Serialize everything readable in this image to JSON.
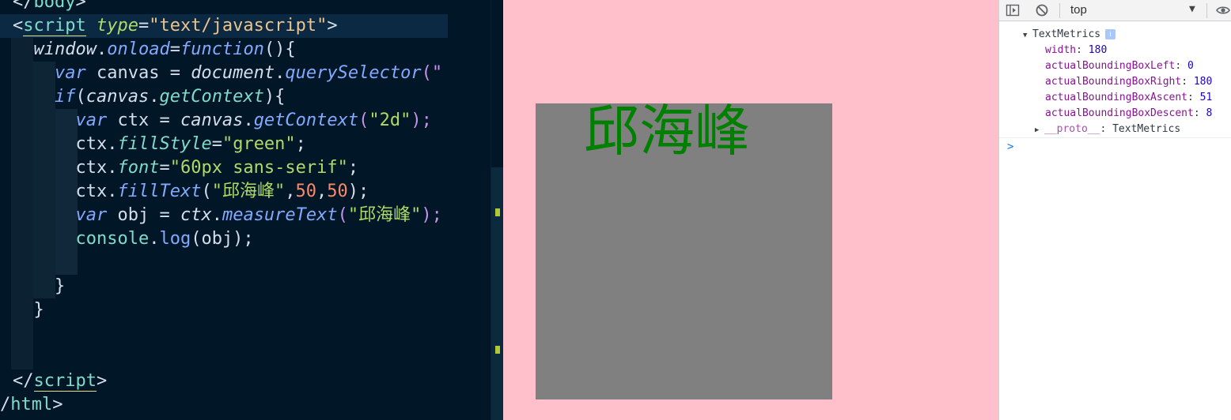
{
  "editor": {
    "lines": [
      [
        {
          "t": "</",
          "c": "punct"
        },
        {
          "t": "body",
          "c": "tag"
        },
        {
          "t": ">",
          "c": "punct"
        }
      ],
      [
        {
          "t": "<",
          "c": "punct"
        },
        {
          "t": "script",
          "c": "tag",
          "u": true
        },
        {
          "t": " ",
          "c": "punct"
        },
        {
          "t": "type",
          "c": "attr"
        },
        {
          "t": "=",
          "c": "punct"
        },
        {
          "t": "\"text/javascript\"",
          "c": "str"
        },
        {
          "t": ">",
          "c": "punct"
        }
      ],
      [
        {
          "t": "  ",
          "c": "punct"
        },
        {
          "t": "window",
          "c": "var"
        },
        {
          "t": ".",
          "c": "punct"
        },
        {
          "t": "onload",
          "c": "fn"
        },
        {
          "t": "=",
          "c": "punct"
        },
        {
          "t": "function",
          "c": "kw"
        },
        {
          "t": "(){",
          "c": "punct"
        }
      ],
      [
        {
          "t": "    ",
          "c": "punct"
        },
        {
          "t": "var",
          "c": "kw"
        },
        {
          "t": " canvas = ",
          "c": "ident"
        },
        {
          "t": "document",
          "c": "var"
        },
        {
          "t": ".",
          "c": "punct"
        },
        {
          "t": "querySelector",
          "c": "fn"
        },
        {
          "t": "(\"",
          "c": "paren"
        }
      ],
      [
        {
          "t": "    ",
          "c": "punct"
        },
        {
          "t": "if",
          "c": "kw"
        },
        {
          "t": "(",
          "c": "punct"
        },
        {
          "t": "canvas",
          "c": "var"
        },
        {
          "t": ".",
          "c": "punct"
        },
        {
          "t": "getContext",
          "c": "prop"
        },
        {
          "t": "){",
          "c": "punct"
        }
      ],
      [
        {
          "t": "      ",
          "c": "punct"
        },
        {
          "t": "var",
          "c": "kw"
        },
        {
          "t": " ctx = ",
          "c": "ident"
        },
        {
          "t": "canvas",
          "c": "var"
        },
        {
          "t": ".",
          "c": "punct"
        },
        {
          "t": "getContext",
          "c": "fn"
        },
        {
          "t": "(",
          "c": "paren"
        },
        {
          "t": "\"2d\"",
          "c": "str2"
        },
        {
          "t": ");",
          "c": "paren"
        }
      ],
      [
        {
          "t": "      ",
          "c": "punct"
        },
        {
          "t": "ctx",
          "c": "ident"
        },
        {
          "t": ".",
          "c": "punct"
        },
        {
          "t": "fillStyle",
          "c": "prop"
        },
        {
          "t": "=",
          "c": "punct"
        },
        {
          "t": "\"green\"",
          "c": "str2"
        },
        {
          "t": ";",
          "c": "punct"
        }
      ],
      [
        {
          "t": "      ",
          "c": "punct"
        },
        {
          "t": "ctx",
          "c": "ident"
        },
        {
          "t": ".",
          "c": "punct"
        },
        {
          "t": "font",
          "c": "prop"
        },
        {
          "t": "=",
          "c": "punct"
        },
        {
          "t": "\"60px sans-serif\"",
          "c": "str2"
        },
        {
          "t": ";",
          "c": "punct"
        }
      ],
      [
        {
          "t": "      ",
          "c": "punct"
        },
        {
          "t": "ctx",
          "c": "ident"
        },
        {
          "t": ".",
          "c": "punct"
        },
        {
          "t": "fillText",
          "c": "fn"
        },
        {
          "t": "(",
          "c": "punct"
        },
        {
          "t": "\"邱海峰\"",
          "c": "str2"
        },
        {
          "t": ",",
          "c": "punct"
        },
        {
          "t": "50",
          "c": "num"
        },
        {
          "t": ",",
          "c": "punct"
        },
        {
          "t": "50",
          "c": "num"
        },
        {
          "t": ");",
          "c": "punct"
        }
      ],
      [
        {
          "t": "      ",
          "c": "punct"
        },
        {
          "t": "var",
          "c": "kw"
        },
        {
          "t": " obj = ",
          "c": "ident"
        },
        {
          "t": "ctx",
          "c": "var"
        },
        {
          "t": ".",
          "c": "punct"
        },
        {
          "t": "measureText",
          "c": "fn"
        },
        {
          "t": "(",
          "c": "paren"
        },
        {
          "t": "\"邱海峰\"",
          "c": "str2"
        },
        {
          "t": ");",
          "c": "paren"
        }
      ],
      [
        {
          "t": "      ",
          "c": "punct"
        },
        {
          "t": "console",
          "c": "prop2"
        },
        {
          "t": ".",
          "c": "punct"
        },
        {
          "t": "log",
          "c": "fn2"
        },
        {
          "t": "(obj);",
          "c": "punct"
        }
      ],
      [
        {
          "t": "",
          "c": "punct"
        }
      ],
      [
        {
          "t": "    }",
          "c": "punct"
        }
      ],
      [
        {
          "t": "  }",
          "c": "punct"
        }
      ],
      [
        {
          "t": "",
          "c": "punct"
        }
      ],
      [
        {
          "t": "",
          "c": "punct"
        }
      ],
      [
        {
          "t": "</",
          "c": "punct"
        },
        {
          "t": "script",
          "c": "tag",
          "u": true
        },
        {
          "t": ">",
          "c": "punct"
        }
      ],
      [
        {
          "t": "/",
          "c": "punct"
        },
        {
          "t": "html",
          "c": "tag"
        },
        {
          "t": ">",
          "c": "punct"
        }
      ]
    ]
  },
  "preview": {
    "canvas_text": "邱海峰",
    "canvas_text_color": "#008000",
    "canvas_bg": "#808080",
    "page_bg": "#ffc0cb"
  },
  "devtools": {
    "toolbar": {
      "sidebar_icon": "sidebar-toggle-icon",
      "clear_icon": "clear-console-icon",
      "context": "top",
      "eye_icon": "live-expression-icon"
    },
    "object_title": "TextMetrics",
    "properties": [
      {
        "key": "width",
        "value": "180"
      },
      {
        "key": "actualBoundingBoxLeft",
        "value": "0"
      },
      {
        "key": "actualBoundingBoxRight",
        "value": "180"
      },
      {
        "key": "actualBoundingBoxAscent",
        "value": "51"
      },
      {
        "key": "actualBoundingBoxDescent",
        "value": "8"
      }
    ],
    "proto": {
      "key": "__proto__",
      "value": "TextMetrics"
    },
    "prompt_symbol": ">"
  }
}
